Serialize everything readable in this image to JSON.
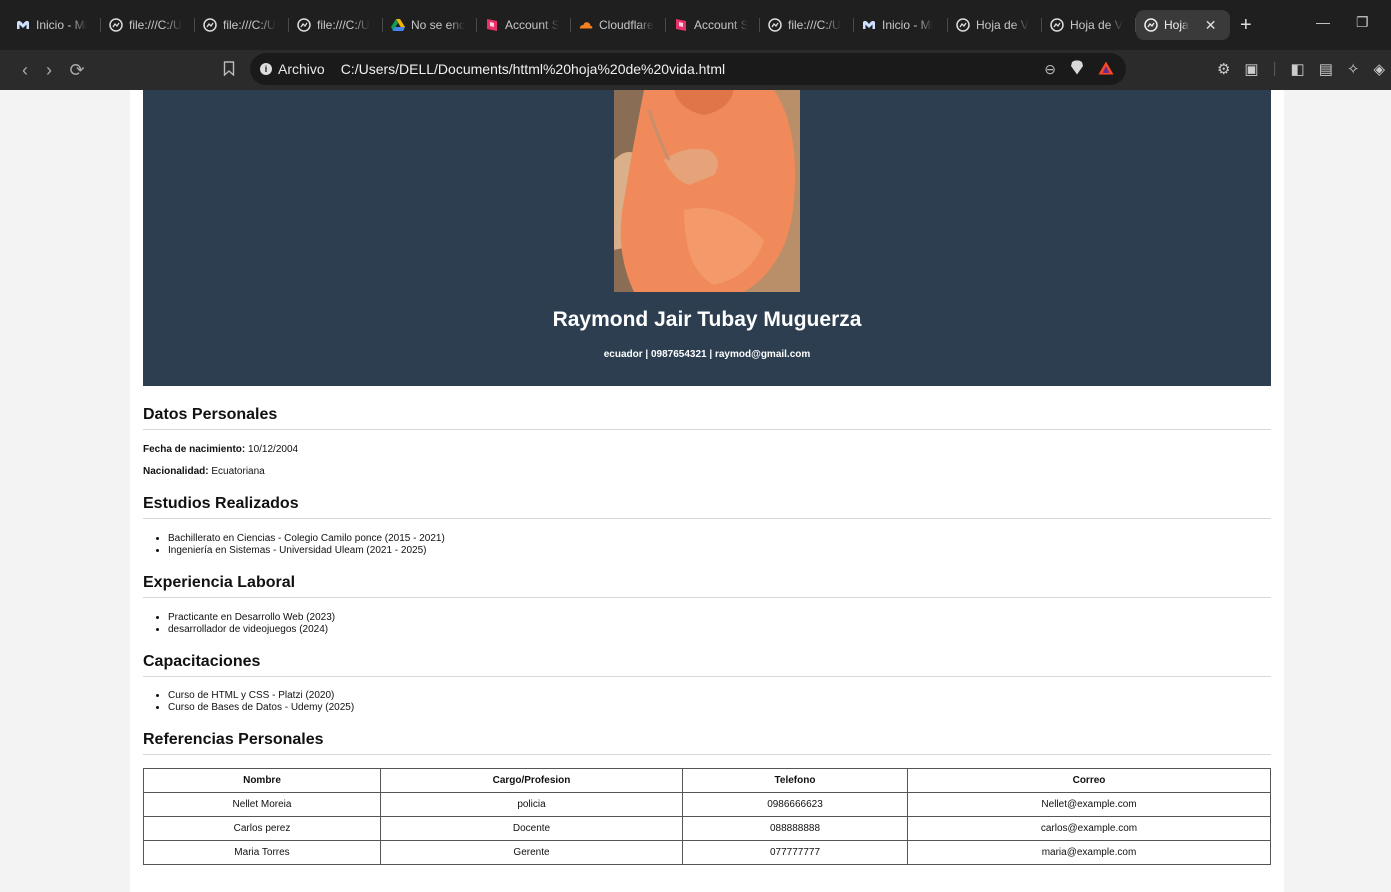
{
  "browser": {
    "tabs": [
      {
        "title": "Inicio - Mi",
        "icon": "m-logo-icon"
      },
      {
        "title": "file:///C:/U",
        "icon": "globe-icon"
      },
      {
        "title": "file:///C:/U",
        "icon": "globe-icon"
      },
      {
        "title": "file:///C:/U",
        "icon": "globe-icon"
      },
      {
        "title": "No se enc",
        "icon": "drive-icon"
      },
      {
        "title": "Account S",
        "icon": "shield-icon"
      },
      {
        "title": "Cloudflare",
        "icon": "cloud-icon"
      },
      {
        "title": "Account S",
        "icon": "shield-icon"
      },
      {
        "title": "file:///C:/U",
        "icon": "globe-icon"
      },
      {
        "title": "Inicio - Mi",
        "icon": "m-logo-icon"
      },
      {
        "title": "Hoja de V",
        "icon": "globe-icon"
      },
      {
        "title": "Hoja de V",
        "icon": "globe-icon"
      },
      {
        "title": "Hoja",
        "icon": "globe-icon",
        "active": true
      }
    ],
    "address": {
      "label": "Archivo",
      "url": "C:/Users/DELL/Documents/httml%20hoja%20de%20vida.html"
    }
  },
  "page": {
    "header": {
      "name": "Raymond Jair Tubay Muguerza",
      "contact": "ecuador | 0987654321 | raymod@gmail.com"
    },
    "personal": {
      "title": "Datos Personales",
      "birth_label": "Fecha de nacimiento:",
      "birth_value": "10/12/2004",
      "nationality_label": "Nacionalidad:",
      "nationality_value": "Ecuatoriana"
    },
    "studies": {
      "title": "Estudios Realizados",
      "items": [
        "Bachillerato en Ciencias - Colegio Camilo ponce (2015 - 2021)",
        "Ingeniería en Sistemas - Universidad Uleam (2021 - 2025)"
      ]
    },
    "experience": {
      "title": "Experiencia Laboral",
      "items": [
        "Practicante en Desarrollo Web (2023)",
        "desarrollador de videojuegos (2024)"
      ]
    },
    "training": {
      "title": "Capacitaciones",
      "items": [
        "Curso de HTML y CSS - Platzi (2020)",
        "Curso de Bases de Datos - Udemy (2025)"
      ]
    },
    "references": {
      "title": "Referencias Personales",
      "headers": [
        "Nombre",
        "Cargo/Profesion",
        "Telefono",
        "Correo"
      ],
      "rows": [
        [
          "Nellet Moreia",
          "policia",
          "0986666623",
          "Nellet@example.com"
        ],
        [
          "Carlos perez",
          "Docente",
          "088888888",
          "carlos@example.com"
        ],
        [
          "Maria Torres",
          "Gerente",
          "077777777",
          "maria@example.com"
        ]
      ]
    }
  },
  "colors": {
    "header_bg": "#2c3e50",
    "chrome_bg": "#1f1f1f"
  }
}
